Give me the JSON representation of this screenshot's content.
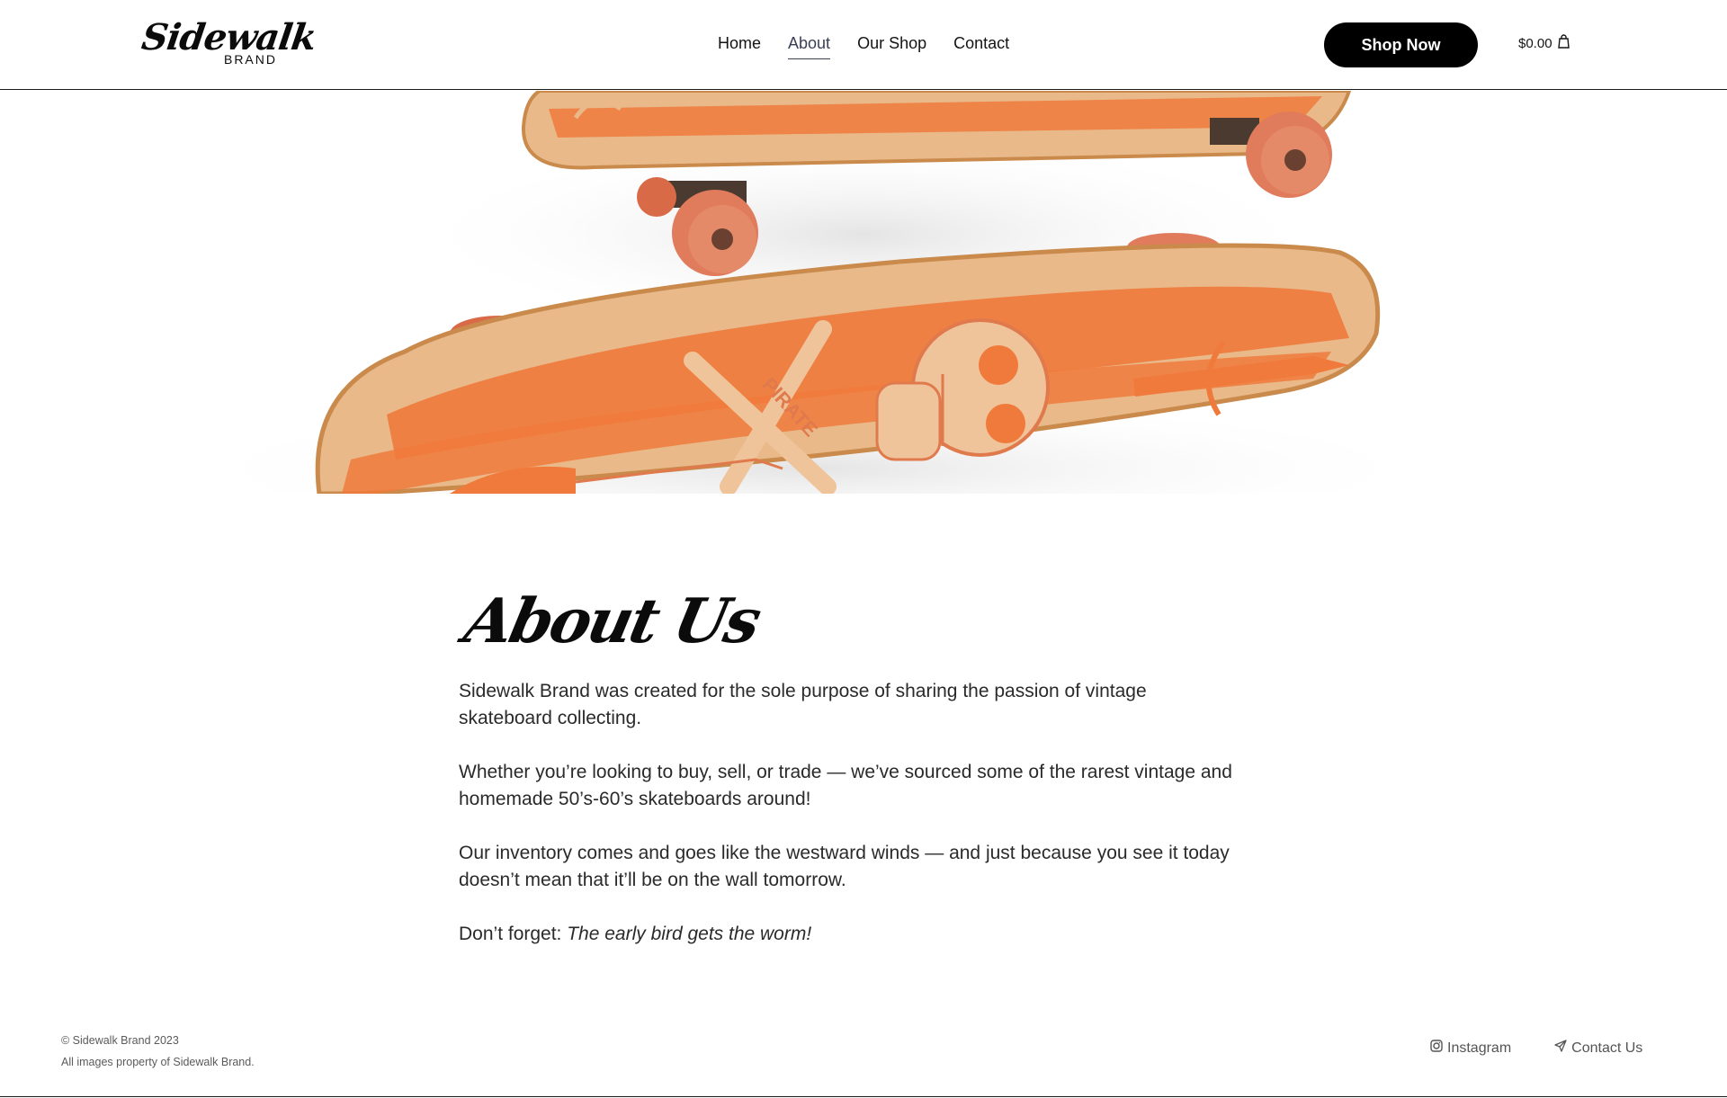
{
  "header": {
    "logo_script": "Sidewalk",
    "logo_sub": "BRAND",
    "nav": [
      {
        "label": "Home",
        "active": false
      },
      {
        "label": "About",
        "active": true
      },
      {
        "label": "Our Shop",
        "active": false
      },
      {
        "label": "Contact",
        "active": false
      }
    ],
    "shop_button": "Shop Now",
    "cart_total": "$0.00",
    "cart_icon": "shopping-bag-icon"
  },
  "hero": {
    "image": "vintage-pirate-skateboards-photo",
    "deck_text": "PIRATE",
    "colors": {
      "wood": "#e9b98a",
      "stripe": "#f07a3c",
      "wheel": "#e07c5c"
    }
  },
  "about": {
    "title": "About Us",
    "paragraphs": [
      "Sidewalk Brand was created for the sole purpose of sharing the passion of vintage skateboard collecting.",
      "Whether you’re looking to buy, sell, or trade — we’ve sourced some of the rarest vintage and homemade 50’s-60’s skateboards around!",
      "Our inventory comes and goes like the westward winds — and just because you see it today doesn’t mean that it’ll be on the wall tomorrow."
    ],
    "closing_prefix": "Don’t forget: ",
    "closing_emphasis": "The early bird gets the worm!"
  },
  "footer": {
    "copyright": "© Sidewalk Brand 2023",
    "rights": "All images property of Sidewalk Brand.",
    "links": [
      {
        "label": "Instagram",
        "icon": "instagram-icon"
      },
      {
        "label": "Contact Us",
        "icon": "paper-plane-icon"
      }
    ]
  }
}
